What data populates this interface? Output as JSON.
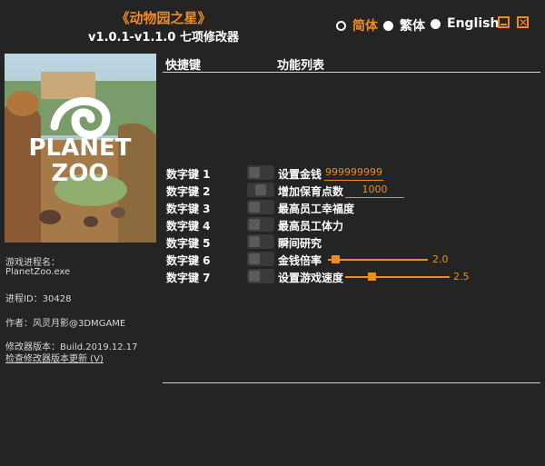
{
  "title": {
    "game": "《动物园之星》",
    "version": "v1.0.1-v1.1.0 七项修改器"
  },
  "languages": [
    {
      "label": "简体",
      "selected": true
    },
    {
      "label": "繁体",
      "selected": false
    },
    {
      "label": "English",
      "selected": false
    }
  ],
  "cover": {
    "logo_line1": "PLANET",
    "logo_line2": "ZOO"
  },
  "info": {
    "process_label": "游戏进程名：",
    "process_name": "PlanetZoo.exe",
    "pid": "进程ID：30428",
    "author": "作者：风灵月影@3DMGAME",
    "build": "修改器版本：Build.2019.12.17",
    "update_link": "检查修改器版本更新 (V)"
  },
  "headers": {
    "hotkey": "快捷键",
    "function": "功能列表"
  },
  "cheats": [
    {
      "hotkey": "数字键 1",
      "name": "设置金钱",
      "value": "999999999"
    },
    {
      "hotkey": "数字键 2",
      "name": "增加保育点数",
      "value": "1000"
    },
    {
      "hotkey": "数字键 3",
      "name": "最高员工幸福度"
    },
    {
      "hotkey": "数字键 4",
      "name": "最高员工体力"
    },
    {
      "hotkey": "数字键 5",
      "name": "瞬间研究"
    },
    {
      "hotkey": "数字键 6",
      "name": "金钱倍率",
      "slider_value": "2.0"
    },
    {
      "hotkey": "数字键 7",
      "name": "设置游戏速度",
      "slider_value": "2.5"
    }
  ],
  "colors": {
    "accent": "#f08c1e",
    "background": "#242424"
  }
}
